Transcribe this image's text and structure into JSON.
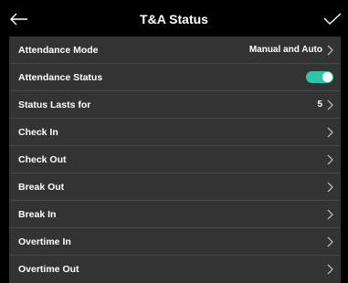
{
  "header": {
    "title": "T&A Status",
    "back_icon": "arrow-left-icon",
    "confirm_icon": "checkmark-icon"
  },
  "settings": {
    "attendance_mode": {
      "label": "Attendance Mode",
      "value": "Manual and Auto"
    },
    "attendance_status": {
      "label": "Attendance Status",
      "enabled": true
    },
    "status_lasts_for": {
      "label": "Status Lasts for",
      "value": "5"
    },
    "items": [
      {
        "label": "Check In"
      },
      {
        "label": "Check Out"
      },
      {
        "label": "Break Out"
      },
      {
        "label": "Break In"
      },
      {
        "label": "Overtime In"
      },
      {
        "label": "Overtime Out"
      }
    ]
  },
  "colors": {
    "background": "#000000",
    "panel": "#333333",
    "divider": "#474747",
    "toggle_on": "#2ec4a6",
    "text": "#ffffff"
  }
}
